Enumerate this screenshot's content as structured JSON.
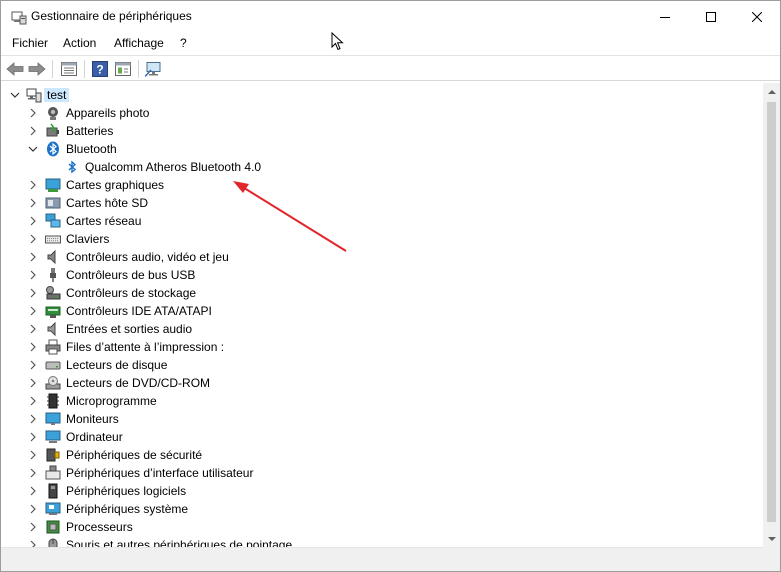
{
  "window": {
    "title": "Gestionnaire de périphériques",
    "icon": "device-manager-icon"
  },
  "menubar": {
    "items": [
      "Fichier",
      "Action",
      "Affichage",
      "?"
    ]
  },
  "toolbar": {
    "buttons": [
      "back-arrow-icon",
      "forward-arrow-icon",
      "properties-icon",
      "help-icon",
      "view-icon",
      "monitor-scan-icon"
    ]
  },
  "tree": {
    "root": "test",
    "categories": [
      {
        "label": "Appareils photo",
        "icon": "camera-icon",
        "expanded": false
      },
      {
        "label": "Batteries",
        "icon": "battery-icon",
        "expanded": false
      },
      {
        "label": "Bluetooth",
        "icon": "bluetooth-icon",
        "expanded": true,
        "children": [
          {
            "label": "Qualcomm Atheros Bluetooth 4.0",
            "icon": "bluetooth-icon"
          }
        ]
      },
      {
        "label": "Cartes graphiques",
        "icon": "display-adapter-icon",
        "expanded": false
      },
      {
        "label": "Cartes hôte SD",
        "icon": "sd-host-icon",
        "expanded": false
      },
      {
        "label": "Cartes réseau",
        "icon": "network-adapter-icon",
        "expanded": false
      },
      {
        "label": "Claviers",
        "icon": "keyboard-icon",
        "expanded": false
      },
      {
        "label": "Contrôleurs audio, vidéo et jeu",
        "icon": "speaker-icon",
        "expanded": false
      },
      {
        "label": "Contrôleurs de bus USB",
        "icon": "usb-icon",
        "expanded": false
      },
      {
        "label": "Contrôleurs de stockage",
        "icon": "storage-controller-icon",
        "expanded": false
      },
      {
        "label": "Contrôleurs IDE ATA/ATAPI",
        "icon": "ide-controller-icon",
        "expanded": false
      },
      {
        "label": "Entrées et sorties audio",
        "icon": "audio-io-icon",
        "expanded": false
      },
      {
        "label": "Files d’attente à l’impression :",
        "icon": "printer-icon",
        "expanded": false
      },
      {
        "label": "Lecteurs de disque",
        "icon": "disk-drive-icon",
        "expanded": false
      },
      {
        "label": "Lecteurs de DVD/CD-ROM",
        "icon": "dvd-icon",
        "expanded": false
      },
      {
        "label": "Microprogramme",
        "icon": "firmware-icon",
        "expanded": false
      },
      {
        "label": "Moniteurs",
        "icon": "monitor-icon",
        "expanded": false
      },
      {
        "label": "Ordinateur",
        "icon": "computer-icon",
        "expanded": false
      },
      {
        "label": "Périphériques de sécurité",
        "icon": "security-device-icon",
        "expanded": false
      },
      {
        "label": "Périphériques d’interface utilisateur",
        "icon": "hid-icon",
        "expanded": false
      },
      {
        "label": "Périphériques logiciels",
        "icon": "software-device-icon",
        "expanded": false
      },
      {
        "label": "Périphériques système",
        "icon": "system-device-icon",
        "expanded": false
      },
      {
        "label": "Processeurs",
        "icon": "processor-icon",
        "expanded": false
      },
      {
        "label": "Souris et autres périphériques de pointage",
        "icon": "mouse-icon",
        "expanded": false
      }
    ]
  },
  "colors": {
    "selection": "#cce8ff",
    "annotation_arrow": "#e0262b",
    "bluetooth": "#1a73c7"
  }
}
